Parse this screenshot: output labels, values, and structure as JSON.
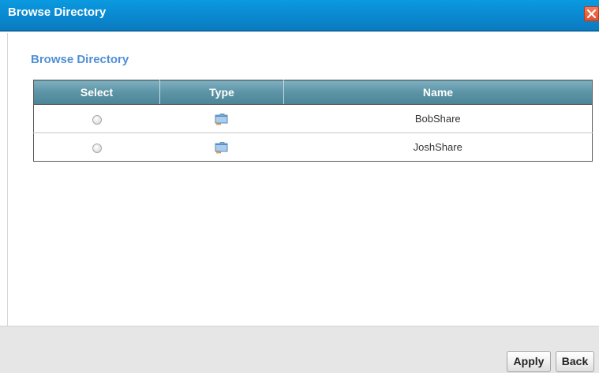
{
  "window": {
    "title": "Browse Directory"
  },
  "section": {
    "title": "Browse Directory"
  },
  "table": {
    "headers": {
      "select": "Select",
      "type": "Type",
      "name": "Name"
    },
    "rows": [
      {
        "selected": false,
        "type_icon": "folder-share-icon",
        "name": "BobShare"
      },
      {
        "selected": false,
        "type_icon": "folder-share-icon",
        "name": "JoshShare"
      }
    ]
  },
  "footer": {
    "apply_label": "Apply",
    "back_label": "Back"
  },
  "colors": {
    "titlebar": "#0a88cf",
    "section_title": "#4f8fd6",
    "table_header": "#5e96a8",
    "close_button": "#e0502e"
  }
}
